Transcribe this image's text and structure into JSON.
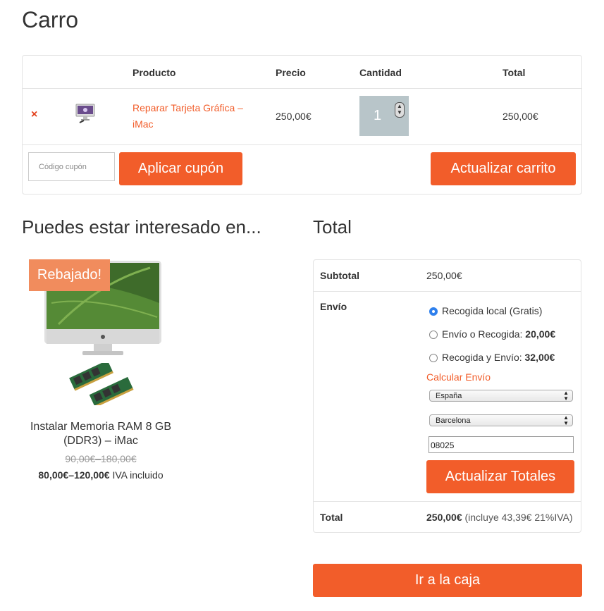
{
  "page": {
    "title": "Carro"
  },
  "cart": {
    "headers": {
      "product": "Producto",
      "price": "Precio",
      "quantity": "Cantidad",
      "total": "Total"
    },
    "item": {
      "remove": "×",
      "name": "Reparar Tarjeta Gráfica – iMac",
      "price": "250,00€",
      "quantity": "1",
      "total": "250,00€"
    },
    "coupon_placeholder": "Código cupón",
    "apply_coupon": "Aplicar cupón",
    "update_cart": "Actualizar carrito"
  },
  "related": {
    "heading": "Puedes estar interesado en...",
    "product": {
      "badge": "Rebajado!",
      "name": "Instalar Memoria RAM 8 GB (DDR3) – iMac",
      "old_price": "90,00€–180,00€",
      "new_price": "80,00€–120,00€",
      "tax_note": "IVA incluido"
    }
  },
  "totals": {
    "heading": "Total",
    "subtotal_label": "Subtotal",
    "subtotal_value": "250,00€",
    "shipping_label": "Envío",
    "options": [
      {
        "label": "Recogida local (Gratis)",
        "price": "",
        "selected": true
      },
      {
        "label": "Envío o Recogida:",
        "price": "20,00€",
        "selected": false
      },
      {
        "label": "Recogida y Envío:",
        "price": "32,00€",
        "selected": false
      }
    ],
    "calc_shipping": "Calcular Envío",
    "country": "España",
    "province": "Barcelona",
    "postcode": "08025",
    "update_totals": "Actualizar Totales",
    "total_label": "Total",
    "total_value": "250,00€",
    "total_note": "(incluye 43,39€ 21%IVA)"
  },
  "checkout_button": "Ir a la caja",
  "colors": {
    "accent": "#f25d2a",
    "badge": "#f18c5d",
    "remove": "#e2401c",
    "qty_bg": "#b8c5c9"
  }
}
